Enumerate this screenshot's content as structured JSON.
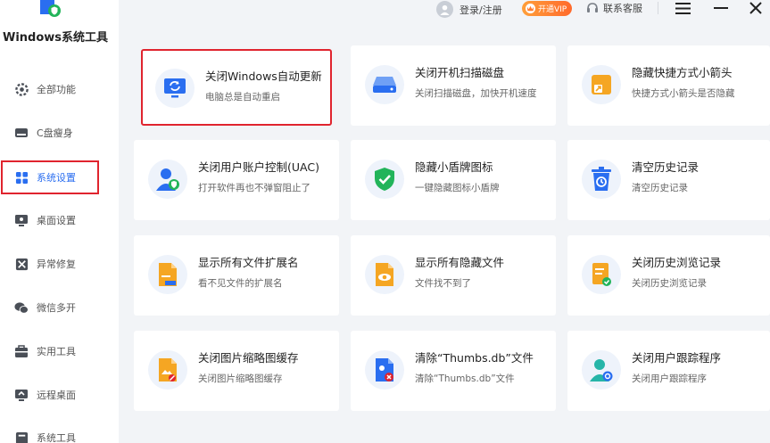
{
  "app": {
    "title": "Windows系统工具"
  },
  "sidebar": {
    "items": [
      {
        "label": "全部功能"
      },
      {
        "label": "C盘瘦身"
      },
      {
        "label": "系统设置"
      },
      {
        "label": "桌面设置"
      },
      {
        "label": "异常修复"
      },
      {
        "label": "微信多开"
      },
      {
        "label": "实用工具"
      },
      {
        "label": "远程桌面"
      },
      {
        "label": "系统工具"
      }
    ],
    "active_index": 2
  },
  "header": {
    "login_label": "登录/注册",
    "vip_label": "开通VIP",
    "service_label": "联系客服"
  },
  "cards": [
    {
      "title": "关闭Windows自动更新",
      "desc": "电脑总是自动重启"
    },
    {
      "title": "关闭开机扫描磁盘",
      "desc": "关闭扫描磁盘，加快开机速度"
    },
    {
      "title": "隐藏快捷方式小箭头",
      "desc": "快捷方式小箭头是否隐藏"
    },
    {
      "title": "关闭用户账户控制(UAC)",
      "desc": "打开软件再也不弹窗阻止了"
    },
    {
      "title": "隐藏小盾牌图标",
      "desc": "一键隐藏图标小盾牌"
    },
    {
      "title": "清空历史记录",
      "desc": "清空历史记录"
    },
    {
      "title": "显示所有文件扩展名",
      "desc": "看不见文件的扩展名"
    },
    {
      "title": "显示所有隐藏文件",
      "desc": "文件找不到了"
    },
    {
      "title": "关闭历史浏览记录",
      "desc": "关闭历史浏览记录"
    },
    {
      "title": "关闭图片缩略图缓存",
      "desc": "关闭图片缩略图缓存"
    },
    {
      "title": "清除“Thumbs.db”文件",
      "desc": "清除“Thumbs.db”文件"
    },
    {
      "title": "关闭用户跟踪程序",
      "desc": "关闭用户跟踪程序"
    }
  ],
  "colors": {
    "accent_blue": "#2a6ef0",
    "highlight_red": "#e0242e",
    "vip_orange": "#ff7a2e",
    "shield_green": "#22b45a",
    "file_orange": "#f5a623"
  }
}
